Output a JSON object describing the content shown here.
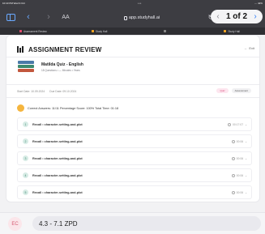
{
  "status_bar": {
    "time": "10:43 PM  Wed 9 Oct",
    "dots": "•••",
    "battery": "⋯ 42%"
  },
  "toolbar": {
    "aa_label": "AA",
    "url": "app.studyhall.ai",
    "pager_label": "1 of 2"
  },
  "tabs": [
    {
      "label": "Assessment Review",
      "fav_color": "#e44c6e"
    },
    {
      "label": "Study Hall",
      "fav_color": "#f5a623"
    },
    {
      "label": "",
      "fav_color": "#888888"
    },
    {
      "label": "Study Hall",
      "fav_color": "#f5a623"
    }
  ],
  "header": {
    "title": "ASSIGNMENT REVIEW",
    "exit_label": "Exit"
  },
  "quiz": {
    "name": "Matilda Quiz - English",
    "meta": "18 Questions  •  — Minutes  •  Years"
  },
  "dates": {
    "start": "Start Date: 10.09.2024",
    "due": "Due Date: 09.10.2024"
  },
  "badges": {
    "status": "Quiz",
    "type": "Assessment"
  },
  "summary": {
    "text": "Correct Answers: 11/11   Percentage Score: 100%   Total Time: 01:18"
  },
  "rows": [
    {
      "num": "1",
      "label": "Recall • character-setting-and-plot",
      "time": "00:17:07"
    },
    {
      "num": "2",
      "label": "Recall • character-setting-and-plot",
      "time": "00:06"
    },
    {
      "num": "3",
      "label": "Recall • character-setting-and-plot",
      "time": "00:06"
    },
    {
      "num": "4",
      "label": "Recall • character-setting-and-plot",
      "time": "00:06"
    },
    {
      "num": "5",
      "label": "Recall • character-setting-and-plot",
      "time": "00:06"
    }
  ],
  "bottom": {
    "avatar": "EC",
    "label": "4.3 - 7.1 ZPD"
  },
  "colors": {
    "chrome": "#3d3d42",
    "accent": "#2d7cf6",
    "success_badge_bg": "#d7ebe5"
  }
}
